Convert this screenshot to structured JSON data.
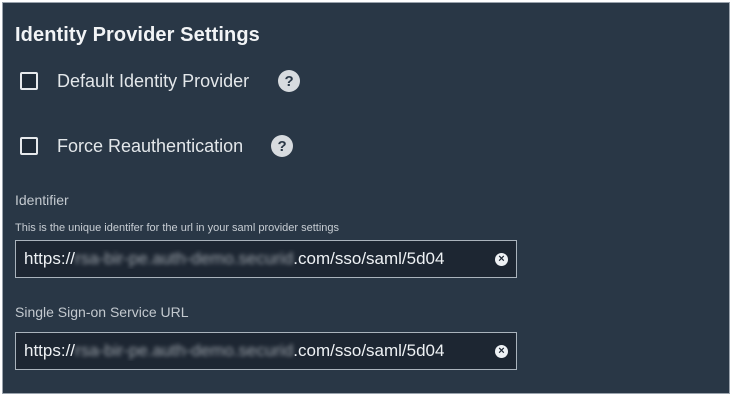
{
  "panel": {
    "title": "Identity Provider Settings"
  },
  "checkboxes": [
    {
      "label": "Default Identity Provider",
      "checked": false,
      "help_glyph": "?"
    },
    {
      "label": "Force Reauthentication",
      "checked": false,
      "help_glyph": "?"
    }
  ],
  "identifier": {
    "label": "Identifier",
    "help_text": "This is the unique identifer for the url in your saml provider settings",
    "value_prefix": "https://",
    "value_redacted": "rsa-bir-pe.auth-demo.securid",
    "value_suffix": ".com/sso/saml/5d04",
    "clear_glyph": "×"
  },
  "sso_url": {
    "label": "Single Sign-on Service URL",
    "value_prefix": "https://",
    "value_redacted": "rsa-bir-pe.auth-demo.securid",
    "value_suffix": ".com/sso/saml/5d04",
    "clear_glyph": "×"
  },
  "colors": {
    "panel_bg": "#293746",
    "input_bg": "#1d2632",
    "text": "#e3e7ea"
  }
}
